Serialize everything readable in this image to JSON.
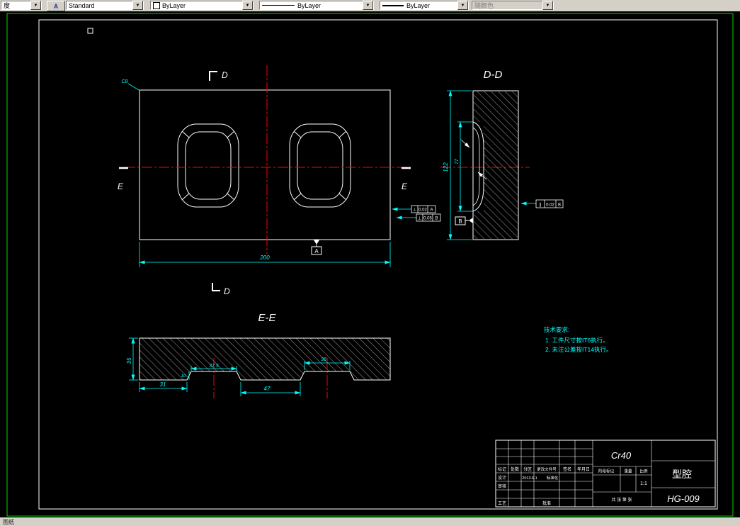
{
  "toolbar": {
    "dim_style": "度",
    "text_style": "Standard",
    "color": "ByLayer",
    "linetype": "ByLayer",
    "lineweight": "ByLayer",
    "plot_style": "随颜色",
    "icons": {
      "text_style_button": "A",
      "dropdown_arrow": "▼"
    }
  },
  "status": {
    "tab": "图纸"
  },
  "colors": {
    "dimension": "#00ffff",
    "centerline": "#ff0000",
    "outline": "#ffffff",
    "viewport_border": "#00d900"
  },
  "drawing": {
    "section_labels": {
      "d": "D",
      "e": "E",
      "dd": "D-D",
      "ee": "E-E"
    },
    "chamfer_note": "C8",
    "dims": {
      "plan_width": "200",
      "dd_height": "122",
      "dd_pocket": "77",
      "ee_height": "35",
      "ee_left_offset": "31",
      "ee_chamfer": "10",
      "ee_left_pocket": "37.5",
      "ee_between": "47",
      "ee_right_pocket": "36"
    },
    "datums": {
      "a": "A",
      "b": "B"
    },
    "tolerance_frames": {
      "perp1": {
        "sym": "⊥",
        "val": "0.02",
        "ref": "A"
      },
      "perp2": {
        "sym": "⊥",
        "val": "0.05",
        "ref": "B"
      },
      "para": {
        "sym": "∥",
        "val": "0.02",
        "ref": "B"
      }
    },
    "tech_req": {
      "title": "技术要求:",
      "line1": "1. 工件尺寸按IT6执行。",
      "line2": "2. 未注公差按IT14执行。"
    },
    "title_block": {
      "material": "Cr40",
      "part_name": "型腔",
      "drawing_no": "HG-009",
      "scale_value": "1:1",
      "headers": {
        "mark": "标记",
        "count": "处数",
        "zone": "分区",
        "change_doc": "更改文件号",
        "sign": "签名",
        "date": "年月日"
      },
      "rows": {
        "design": "设计",
        "design_date": "2013.6.1",
        "standard": "标准化",
        "check": "审核",
        "process": "工艺",
        "approve": "批准"
      },
      "stage": "阶段标记",
      "weight": "重量",
      "scale": "比例",
      "sheets": "共 张 第 张"
    }
  }
}
